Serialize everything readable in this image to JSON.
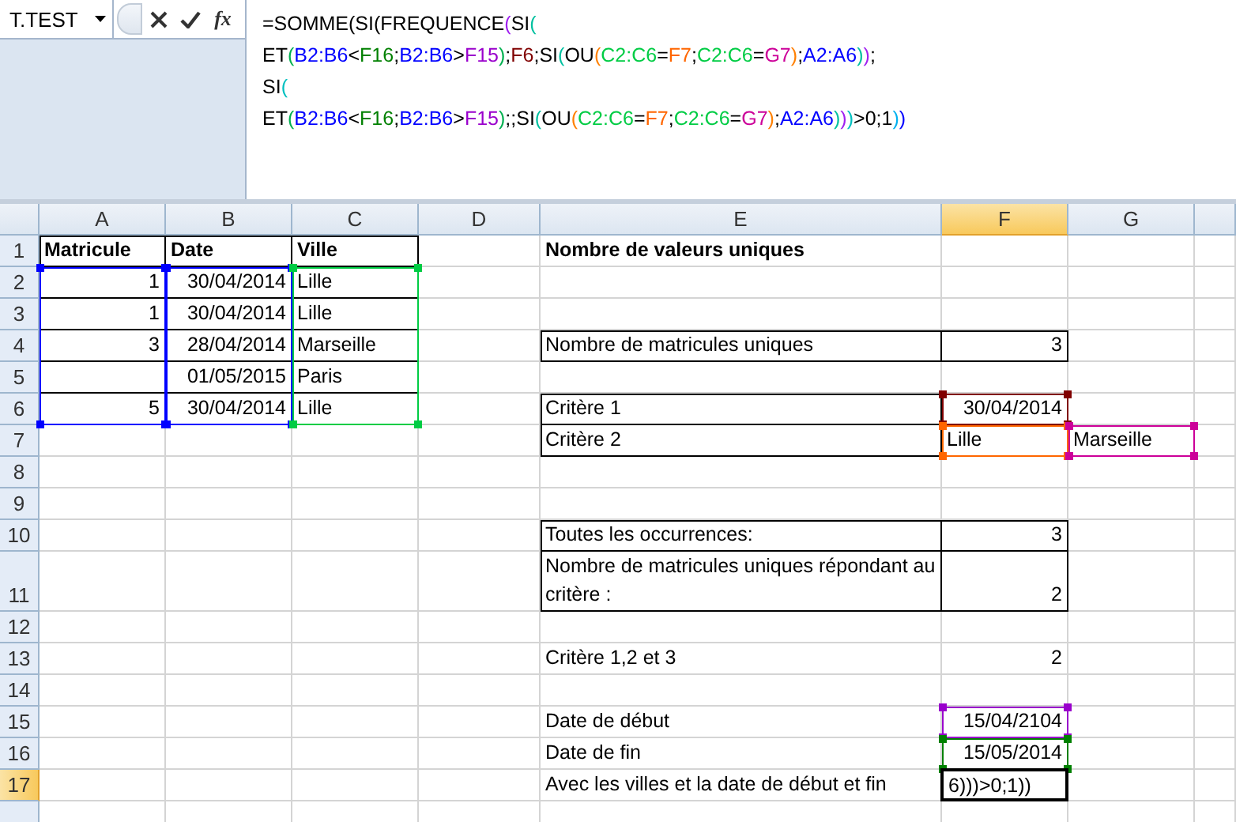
{
  "name_box": {
    "value": "T.TEST"
  },
  "formula_bar": {
    "function_label": "fx",
    "lines": [
      {
        "segments": [
          {
            "text": "=SOMME(SI(FREQUENCE",
            "color": "#000000"
          },
          {
            "text": "(",
            "color": "#a020f0"
          },
          {
            "text": "SI",
            "color": "#000000"
          },
          {
            "text": "(",
            "color": "#00c0a0"
          }
        ]
      },
      {
        "segments": [
          {
            "text": "ET",
            "color": "#000000"
          },
          {
            "text": "(",
            "color": "#00b050"
          },
          {
            "text": "B2:B6",
            "color": "#0000ff"
          },
          {
            "text": "<",
            "color": "#000000"
          },
          {
            "text": "F16",
            "color": "#008000"
          },
          {
            "text": ";",
            "color": "#000000"
          },
          {
            "text": "B2:B6",
            "color": "#0000ff"
          },
          {
            "text": ">",
            "color": "#000000"
          },
          {
            "text": "F15",
            "color": "#9900cc"
          },
          {
            "text": ")",
            "color": "#00b050"
          },
          {
            "text": ";",
            "color": "#000000"
          },
          {
            "text": "F6",
            "color": "#800000"
          },
          {
            "text": ";SI",
            "color": "#000000"
          },
          {
            "text": "(",
            "color": "#00c0a0"
          },
          {
            "text": "OU",
            "color": "#000000"
          },
          {
            "text": "(",
            "color": "#ff8000"
          },
          {
            "text": "C2:C6",
            "color": "#00cc44"
          },
          {
            "text": "=",
            "color": "#000000"
          },
          {
            "text": "F7",
            "color": "#ff6600"
          },
          {
            "text": ";",
            "color": "#000000"
          },
          {
            "text": "C2:C6",
            "color": "#00cc44"
          },
          {
            "text": "=",
            "color": "#000000"
          },
          {
            "text": "G7",
            "color": "#cc0099"
          },
          {
            "text": ")",
            "color": "#ff8000"
          },
          {
            "text": ";",
            "color": "#000000"
          },
          {
            "text": "A2:A6",
            "color": "#0000ff"
          },
          {
            "text": ")",
            "color": "#00c0a0"
          },
          {
            "text": ")",
            "color": "#a020f0"
          },
          {
            "text": ";",
            "color": "#000000"
          }
        ]
      },
      {
        "segments": [
          {
            "text": "SI",
            "color": "#000000"
          },
          {
            "text": "(",
            "color": "#00c0c0"
          }
        ]
      },
      {
        "segments": [
          {
            "text": "ET",
            "color": "#000000"
          },
          {
            "text": "(",
            "color": "#00b050"
          },
          {
            "text": "B2:B6",
            "color": "#0000ff"
          },
          {
            "text": "<",
            "color": "#000000"
          },
          {
            "text": "F16",
            "color": "#008000"
          },
          {
            "text": ";",
            "color": "#000000"
          },
          {
            "text": "B2:B6",
            "color": "#0000ff"
          },
          {
            "text": ">",
            "color": "#000000"
          },
          {
            "text": "F15",
            "color": "#9900cc"
          },
          {
            "text": ")",
            "color": "#00b050"
          },
          {
            "text": ";;SI",
            "color": "#000000"
          },
          {
            "text": "(",
            "color": "#00c0a0"
          },
          {
            "text": "OU",
            "color": "#000000"
          },
          {
            "text": "(",
            "color": "#ff8000"
          },
          {
            "text": "C2:C6",
            "color": "#00cc44"
          },
          {
            "text": "=",
            "color": "#000000"
          },
          {
            "text": "F7",
            "color": "#ff6600"
          },
          {
            "text": ";",
            "color": "#000000"
          },
          {
            "text": "C2:C6",
            "color": "#00cc44"
          },
          {
            "text": "=",
            "color": "#000000"
          },
          {
            "text": "G7",
            "color": "#cc0099"
          },
          {
            "text": ")",
            "color": "#ff8000"
          },
          {
            "text": ";",
            "color": "#000000"
          },
          {
            "text": "A2:A6",
            "color": "#0000ff"
          },
          {
            "text": ")",
            "color": "#00c0a0"
          },
          {
            "text": ")",
            "color": "#a020f0"
          },
          {
            "text": ")",
            "color": "#00c0c0"
          },
          {
            "text": ">0;1",
            "color": "#000000"
          },
          {
            "text": ")",
            "color": "#00b0f0"
          },
          {
            "text": ")",
            "color": "#0000ff"
          }
        ]
      }
    ]
  },
  "columns": [
    {
      "label": "A",
      "selected": false
    },
    {
      "label": "B",
      "selected": false
    },
    {
      "label": "C",
      "selected": false
    },
    {
      "label": "D",
      "selected": false
    },
    {
      "label": "E",
      "selected": false
    },
    {
      "label": "F",
      "selected": true
    },
    {
      "label": "G",
      "selected": false
    }
  ],
  "rows": [
    {
      "label": "1",
      "selected": false,
      "cells": [
        {
          "text": "Matricule",
          "kind": "header"
        },
        {
          "text": "Date",
          "kind": "header"
        },
        {
          "text": "Ville",
          "kind": "header"
        },
        {},
        {
          "text": "Nombre de valeurs uniques",
          "kind": "header"
        }
      ]
    },
    {
      "label": "2",
      "selected": false,
      "cells": [
        {
          "text": "1",
          "kind": "number",
          "color": "#0000ff"
        },
        {
          "text": "30/04/2014",
          "kind": "number",
          "color": "#0000ff"
        },
        {
          "text": "Lille",
          "kind": "text",
          "color": "#00cc44"
        }
      ]
    },
    {
      "label": "3",
      "selected": false,
      "cells": [
        {
          "text": "1",
          "kind": "number",
          "color": "#0000ff"
        },
        {
          "text": "30/04/2014",
          "kind": "number",
          "color": "#0000ff"
        },
        {
          "text": "Lille",
          "kind": "text",
          "color": "#00cc44"
        }
      ]
    },
    {
      "label": "4",
      "selected": false,
      "cells": [
        {
          "text": "3",
          "kind": "number",
          "color": "#0000ff"
        },
        {
          "text": "28/04/2014",
          "kind": "number",
          "color": "#0000ff"
        },
        {
          "text": "Marseille",
          "kind": "text",
          "color": "#00cc44"
        },
        {},
        {
          "text": "Nombre de matricules uniques",
          "kind": "text"
        },
        {
          "text": "3",
          "kind": "number"
        }
      ]
    },
    {
      "label": "5",
      "selected": false,
      "cells": [
        {
          "kind": "number",
          "color": "#0000ff"
        },
        {
          "text": "01/05/2015",
          "kind": "number",
          "color": "#0000ff"
        },
        {
          "text": "Paris",
          "kind": "text",
          "color": "#00cc44"
        }
      ]
    },
    {
      "label": "6",
      "selected": false,
      "cells": [
        {
          "text": "5",
          "kind": "number",
          "color": "#0000ff"
        },
        {
          "text": "30/04/2014",
          "kind": "number",
          "color": "#0000ff"
        },
        {
          "text": "Lille",
          "kind": "text",
          "color": "#00cc44"
        },
        {},
        {
          "text": "Critère 1",
          "kind": "text"
        },
        {
          "text": "30/04/2014",
          "kind": "number",
          "color": "#800000"
        }
      ]
    },
    {
      "label": "7",
      "selected": false,
      "cells": [
        {},
        {},
        {},
        {},
        {
          "text": "Critère 2",
          "kind": "text"
        },
        {
          "text": "Lille",
          "kind": "text",
          "color": "#ff6600"
        },
        {
          "text": "Marseille",
          "kind": "text",
          "color": "#cc0099"
        }
      ]
    },
    {
      "label": "8",
      "selected": false
    },
    {
      "label": "9",
      "selected": false
    },
    {
      "label": "10",
      "selected": false,
      "cells": [
        {},
        {},
        {},
        {},
        {
          "text": "Toutes les occurrences:",
          "kind": "text"
        },
        {
          "text": "3",
          "kind": "number"
        }
      ]
    },
    {
      "label": "11",
      "selected": false,
      "cells": [
        {},
        {},
        {},
        {},
        {
          "text": "Nombre de matricules uniques répondant au critère :",
          "kind": "text"
        },
        {
          "text": "2",
          "kind": "number"
        }
      ]
    },
    {
      "label": "12",
      "selected": false
    },
    {
      "label": "13",
      "selected": false,
      "cells": [
        {},
        {},
        {},
        {},
        {
          "text": "Critère 1,2 et 3",
          "kind": "text"
        },
        {
          "text": "2",
          "kind": "number"
        }
      ]
    },
    {
      "label": "14",
      "selected": false
    },
    {
      "label": "15",
      "selected": false,
      "cells": [
        {},
        {},
        {},
        {},
        {
          "text": "Date de début",
          "kind": "text"
        },
        {
          "text": "15/04/2104",
          "kind": "number",
          "color": "#9900cc"
        }
      ]
    },
    {
      "label": "16",
      "selected": false,
      "cells": [
        {},
        {},
        {},
        {},
        {
          "text": "Date de fin",
          "kind": "text"
        },
        {
          "text": "15/05/2014",
          "kind": "number",
          "color": "#008000"
        }
      ]
    },
    {
      "label": "17",
      "selected": true,
      "cells": [
        {},
        {},
        {},
        {},
        {
          "text": "Avec les villes et la date de début et fin",
          "kind": "text"
        },
        {
          "text": "6)))>0;1))",
          "kind": "editing"
        }
      ]
    }
  ]
}
